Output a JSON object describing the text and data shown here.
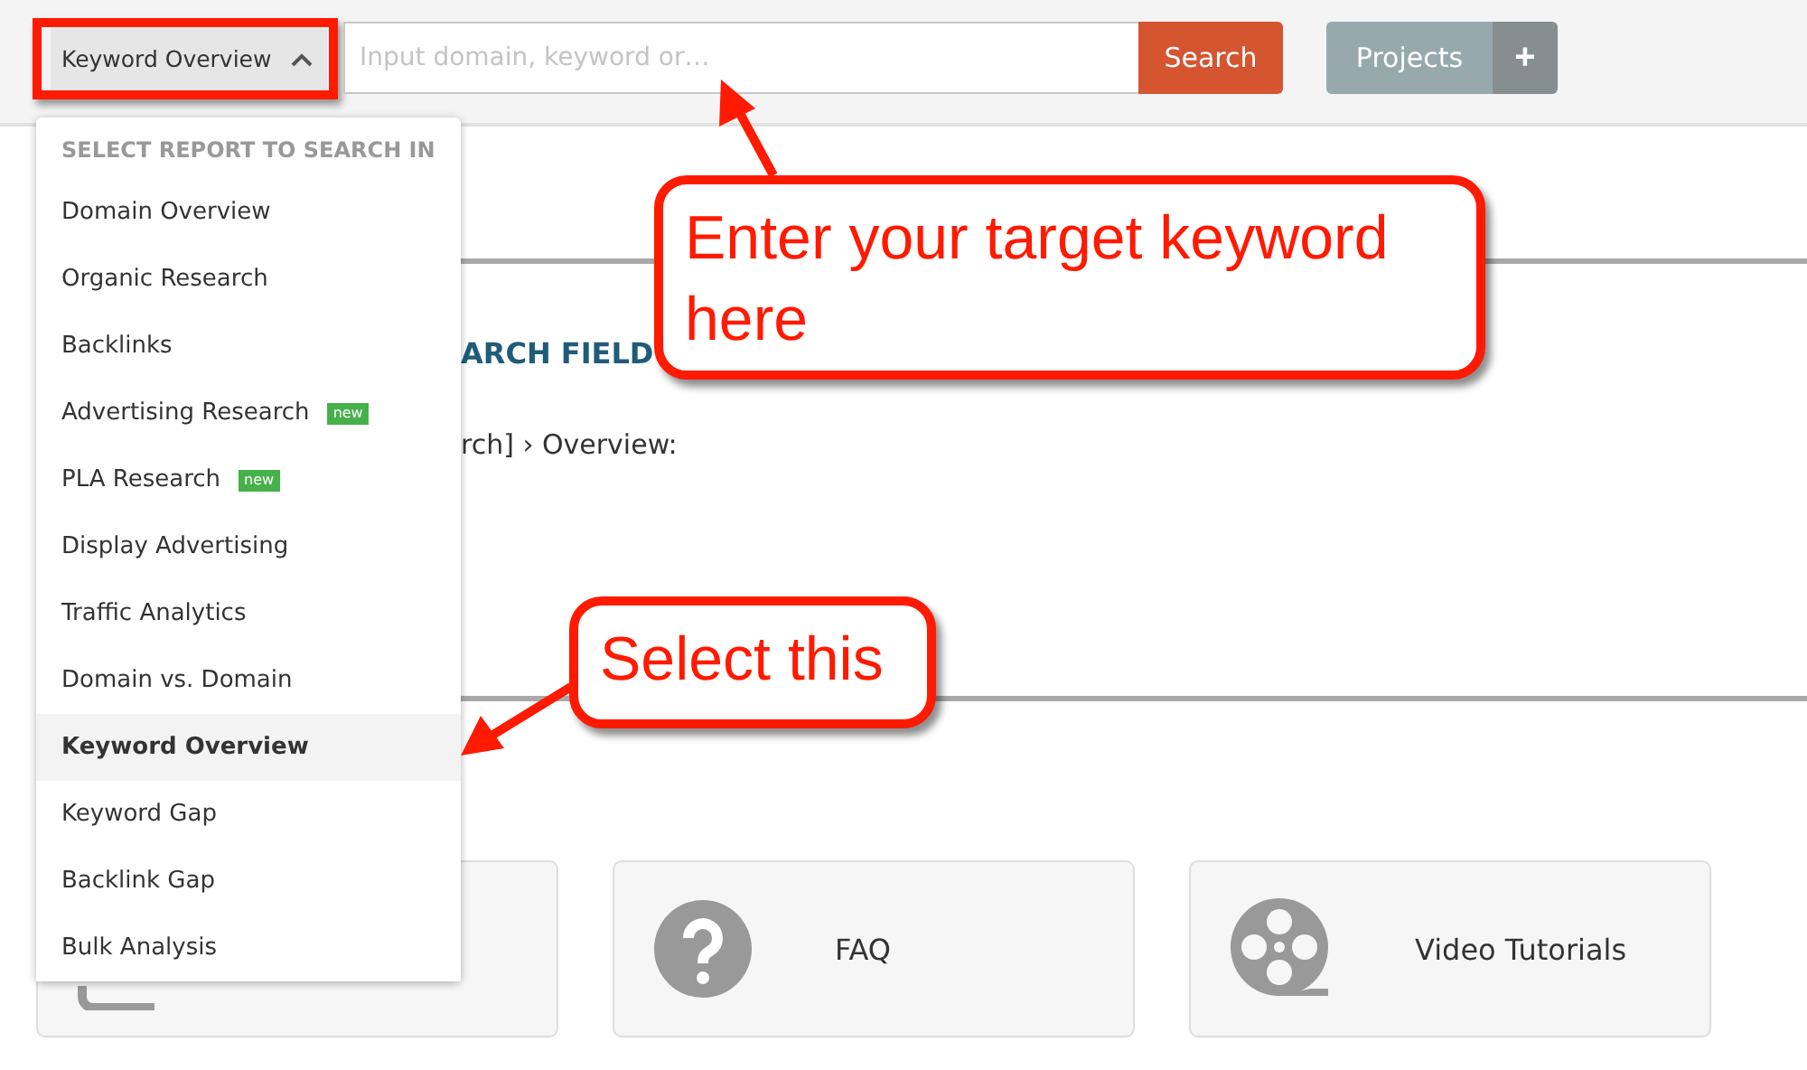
{
  "toolbar": {
    "report_selector": {
      "label": "Keyword Overview",
      "expanded": true
    },
    "search": {
      "placeholder": "Input domain, keyword or…"
    },
    "search_button": "Search",
    "projects_button": "Projects",
    "add_button": "+"
  },
  "dropdown": {
    "heading": "SELECT REPORT TO SEARCH IN",
    "items": [
      {
        "label": "Domain Overview",
        "selected": false
      },
      {
        "label": "Organic Research",
        "selected": false
      },
      {
        "label": "Backlinks",
        "selected": false
      },
      {
        "label": "Advertising Research",
        "selected": false,
        "badge": "new"
      },
      {
        "label": "PLA Research",
        "selected": false,
        "badge": "new"
      },
      {
        "label": "Display Advertising",
        "selected": false
      },
      {
        "label": "Traffic Analytics",
        "selected": false
      },
      {
        "label": "Domain vs. Domain",
        "selected": false
      },
      {
        "label": "Keyword Overview",
        "selected": true
      },
      {
        "label": "Keyword Gap",
        "selected": false
      },
      {
        "label": "Backlink Gap",
        "selected": false
      },
      {
        "label": "Bulk Analysis",
        "selected": false
      }
    ]
  },
  "page": {
    "heading": "ARCH FIELD",
    "breadcrumb": "rch] › Overview:"
  },
  "cards": [
    {
      "kind": "covered"
    },
    {
      "kind": "faq",
      "label": "FAQ"
    },
    {
      "kind": "video",
      "label": "Video Tutorials"
    }
  ],
  "annotations": [
    {
      "text": "Enter your target keyword here"
    },
    {
      "text": "Select this"
    }
  ]
}
